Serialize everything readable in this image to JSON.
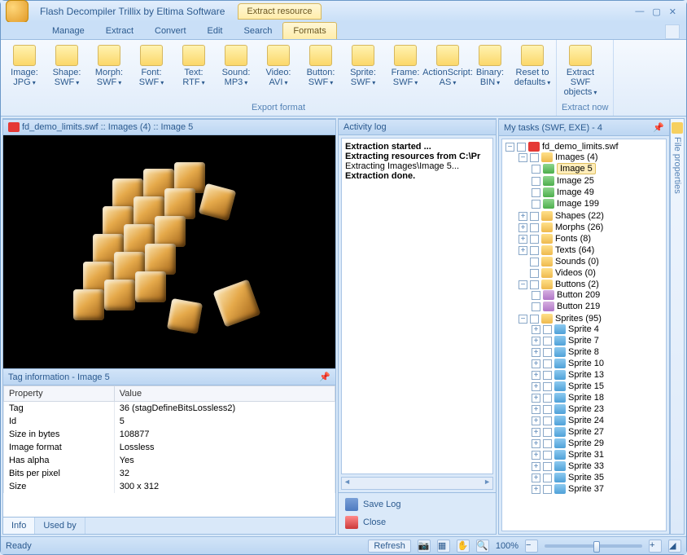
{
  "window": {
    "title": "Flash Decompiler Trillix by Eltima Software",
    "context_tab": "Extract resource",
    "controls": {
      "min": "—",
      "restore": "▢",
      "close": "✕"
    }
  },
  "ribbon": {
    "tabs": [
      "Manage",
      "Extract",
      "Convert",
      "Edit",
      "Search",
      "Formats"
    ],
    "active_tab": "Formats",
    "groups": [
      {
        "label": "Export format",
        "items": [
          {
            "l1": "Image:",
            "l2": "JPG"
          },
          {
            "l1": "Shape:",
            "l2": "SWF"
          },
          {
            "l1": "Morph:",
            "l2": "SWF"
          },
          {
            "l1": "Font:",
            "l2": "SWF"
          },
          {
            "l1": "Text:",
            "l2": "RTF"
          },
          {
            "l1": "Sound:",
            "l2": "MP3"
          },
          {
            "l1": "Video:",
            "l2": "AVI"
          },
          {
            "l1": "Button:",
            "l2": "SWF"
          },
          {
            "l1": "Sprite:",
            "l2": "SWF"
          },
          {
            "l1": "Frame:",
            "l2": "SWF"
          },
          {
            "l1": "ActionScript:",
            "l2": "AS"
          },
          {
            "l1": "Binary:",
            "l2": "BIN"
          },
          {
            "l1": "Reset to",
            "l2": "defaults"
          }
        ]
      },
      {
        "label": "Extract now",
        "items": [
          {
            "l1": "Extract SWF",
            "l2": "objects"
          }
        ]
      }
    ]
  },
  "preview": {
    "title_prefix": "fd_demo_limits.swf :: Images (4) :: Image 5"
  },
  "taginfo": {
    "title": "Tag information - Image 5",
    "cols": [
      "Property",
      "Value"
    ],
    "rows": [
      [
        "Tag",
        "36 (stagDefineBitsLossless2)"
      ],
      [
        "Id",
        "5"
      ],
      [
        "Size in bytes",
        "108877"
      ],
      [
        "Image format",
        "Lossless"
      ],
      [
        "Has alpha",
        "Yes"
      ],
      [
        "Bits per pixel",
        "32"
      ],
      [
        "Size",
        "300 x 312"
      ]
    ],
    "tabs": [
      "Info",
      "Used by"
    ]
  },
  "activity": {
    "title": "Activity log",
    "lines": [
      {
        "t": "Extraction started ...",
        "b": true
      },
      {
        "t": "Extracting resources from C:\\Pr",
        "b": true
      },
      {
        "t": "Extracting Images\\Image 5...",
        "b": false
      },
      {
        "t": "Extraction done.",
        "b": true
      }
    ],
    "save_label": "Save Log",
    "close_label": "Close"
  },
  "tasks": {
    "title": "My tasks (SWF, EXE) - 4",
    "root": "fd_demo_limits.swf",
    "images_label": "Images (4)",
    "images": [
      "Image 5",
      "Image 25",
      "Image 49",
      "Image 199"
    ],
    "images_selected": "Image 5",
    "categories": [
      {
        "name": "Shapes (22)",
        "exp": "+"
      },
      {
        "name": "Morphs (26)",
        "exp": "+"
      },
      {
        "name": "Fonts (8)",
        "exp": "+"
      },
      {
        "name": "Texts (64)",
        "exp": "+"
      },
      {
        "name": "Sounds (0)",
        "exp": ""
      },
      {
        "name": "Videos (0)",
        "exp": ""
      }
    ],
    "buttons_label": "Buttons (2)",
    "buttons": [
      "Button 209",
      "Button 219"
    ],
    "sprites_label": "Sprites (95)",
    "sprites": [
      "Sprite 4",
      "Sprite 7",
      "Sprite 8",
      "Sprite 10",
      "Sprite 13",
      "Sprite 15",
      "Sprite 18",
      "Sprite 23",
      "Sprite 24",
      "Sprite 27",
      "Sprite 29",
      "Sprite 31",
      "Sprite 33",
      "Sprite 35",
      "Sprite 37"
    ]
  },
  "sidebar": {
    "label": "File properties"
  },
  "status": {
    "ready": "Ready",
    "refresh": "Refresh",
    "zoom": "100%"
  }
}
